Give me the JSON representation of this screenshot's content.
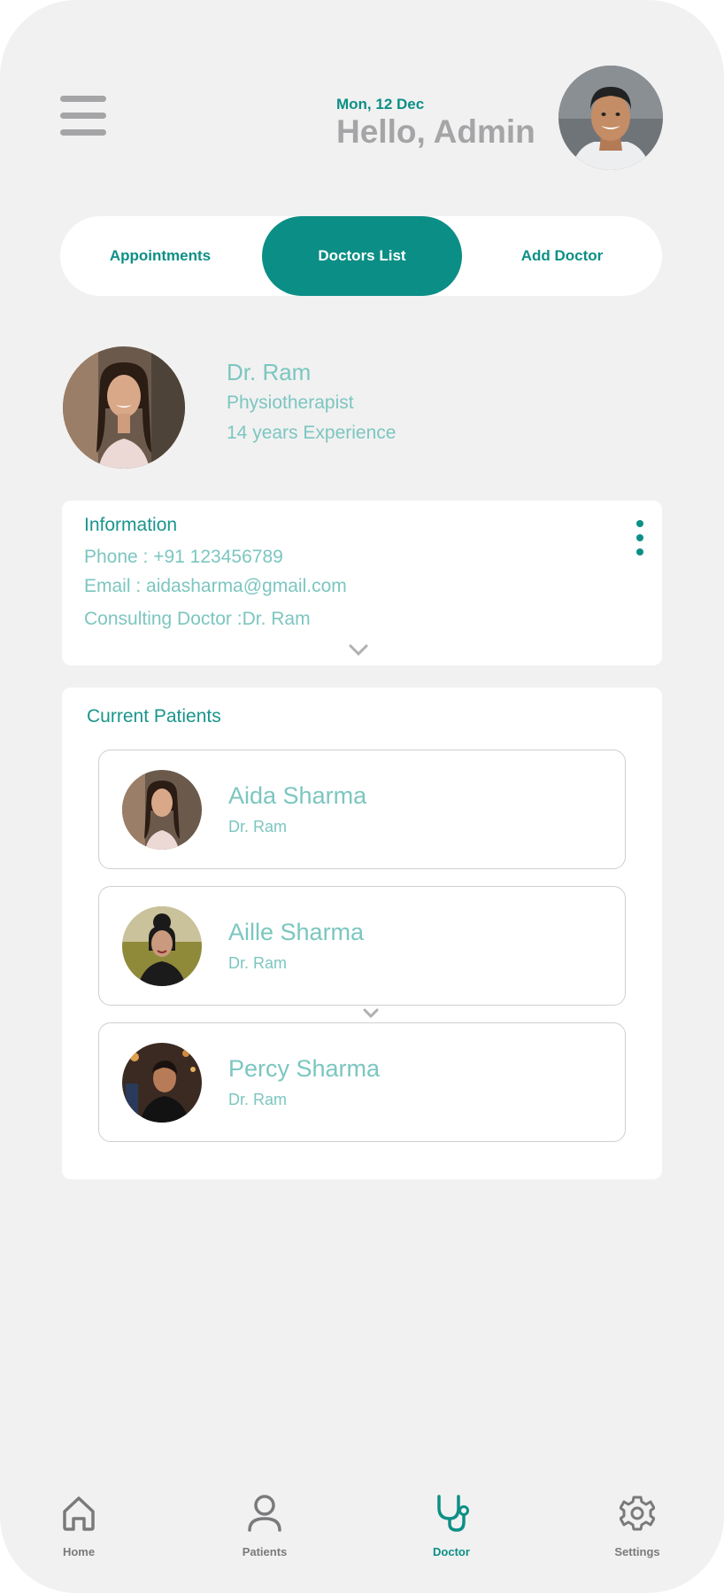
{
  "header": {
    "date": "Mon, 12 Dec",
    "greeting": "Hello, Admin"
  },
  "tabs": [
    {
      "label": "Appointments",
      "active": false
    },
    {
      "label": "Doctors List",
      "active": true
    },
    {
      "label": "Add Doctor",
      "active": false
    }
  ],
  "doctor": {
    "name": "Dr. Ram",
    "specialty": "Physiotherapist",
    "experience": "14 years Experience"
  },
  "information": {
    "title": "Information",
    "phone": "Phone : +91 123456789",
    "email": "Email : aidasharma@gmail.com",
    "consulting": "Consulting Doctor :Dr. Ram"
  },
  "current_patients": {
    "title": "Current Patients",
    "items": [
      {
        "name": "Aida Sharma",
        "doctor": "Dr. Ram"
      },
      {
        "name": "Aille Sharma",
        "doctor": "Dr. Ram"
      },
      {
        "name": "Percy Sharma",
        "doctor": "Dr. Ram"
      }
    ]
  },
  "bottom_nav": [
    {
      "label": "Home",
      "icon": "home-icon",
      "active": false
    },
    {
      "label": "Patients",
      "icon": "user-icon",
      "active": false
    },
    {
      "label": "Doctor",
      "icon": "stethoscope-icon",
      "active": true
    },
    {
      "label": "Settings",
      "icon": "gear-icon",
      "active": false
    }
  ],
  "colors": {
    "accent": "#0b8e85",
    "accent_light": "#7cc6c0",
    "background": "#f1f1f1",
    "muted": "#a5a5a7"
  }
}
